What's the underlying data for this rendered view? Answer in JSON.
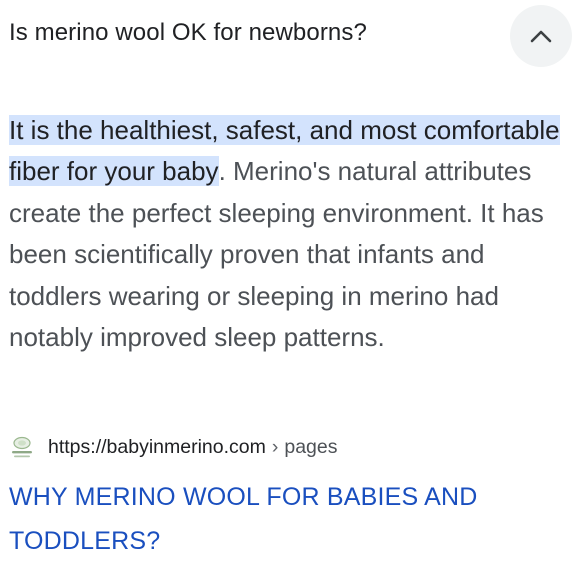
{
  "question": "Is merino wool OK for newborns?",
  "collapse_icon": "chevron-up-icon",
  "answer": {
    "highlight": "It is the healthiest, safest, and most comfortable fiber for your baby",
    "rest": ". Merino's natural attributes create the perfect sleeping environment. It has been scientifically proven that infants and toddlers wearing or sleeping in merino had notably improved sleep patterns."
  },
  "source": {
    "favicon": "site-favicon-icon",
    "url": "https://babyinmerino.com",
    "separator": "›",
    "path": "pages"
  },
  "result_title": "WHY MERINO WOOL FOR BABIES AND TODDLERS?",
  "colors": {
    "highlight_bg": "#d3e3fd",
    "link": "#1a4fbf",
    "button_bg": "#f1f3f4"
  }
}
